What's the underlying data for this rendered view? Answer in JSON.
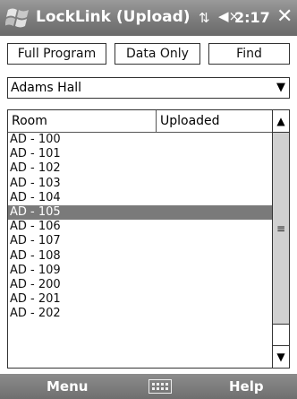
{
  "titlebar": {
    "title": "LockLink (Upload)",
    "time": "2:17",
    "close": "✕",
    "net_icon": "⇅",
    "vol_icon": "◀×"
  },
  "toolbar": {
    "full_program": "Full Program",
    "data_only": "Data Only",
    "find": "Find"
  },
  "building": {
    "selected": "Adams Hall"
  },
  "list": {
    "headers": {
      "room": "Room",
      "uploaded": "Uploaded"
    },
    "rows": [
      "AD - 100",
      "AD - 101",
      "AD - 102",
      "AD - 103",
      "AD - 104",
      "AD - 105",
      "AD - 106",
      "AD - 107",
      "AD - 108",
      "AD - 109",
      "AD - 200",
      "AD - 201",
      "AD - 202"
    ],
    "selected_index": 5
  },
  "bottombar": {
    "menu": "Menu",
    "help": "Help"
  }
}
